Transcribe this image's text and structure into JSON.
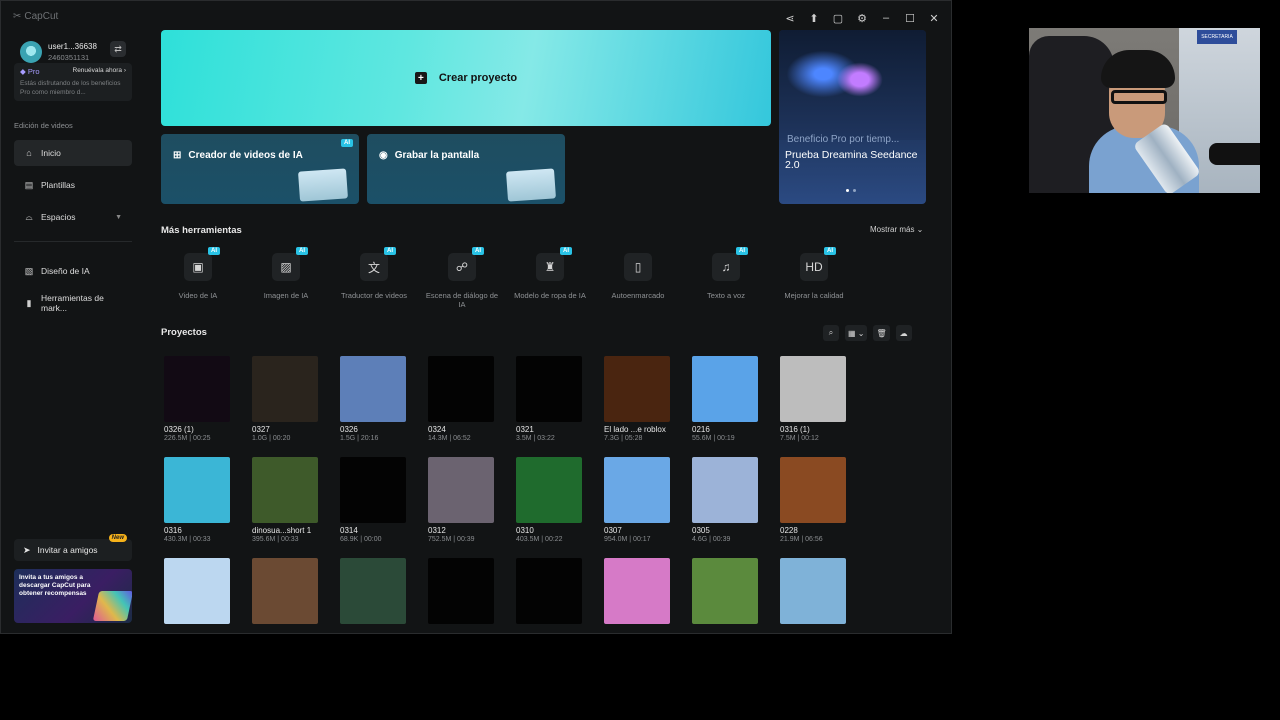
{
  "app": {
    "brand": "CapCut"
  },
  "window_controls": [
    "share",
    "upload",
    "feedback",
    "settings",
    "minimize",
    "maximize",
    "close"
  ],
  "user": {
    "name": "user1...36638",
    "id": "2460351131"
  },
  "pro": {
    "tag": "Pro",
    "renew": "Renuévala ahora",
    "desc": "Estás disfrutando de los beneficios Pro como miembro d..."
  },
  "sidebar": {
    "section_label": "Edición de videos",
    "items": [
      {
        "label": "Inicio",
        "icon": "home-icon"
      },
      {
        "label": "Plantillas",
        "icon": "templates-icon"
      },
      {
        "label": "Espacios",
        "icon": "spaces-icon"
      },
      {
        "label": "Diseño de IA",
        "icon": "ai-design-icon"
      },
      {
        "label": "Herramientas de mark...",
        "icon": "marketing-tools-icon"
      }
    ],
    "invite": {
      "label": "Invitar a amigos",
      "badge": "New"
    },
    "promo": "Invita a tus amigos a descargar CapCut para obtener recompensas"
  },
  "hero": {
    "label": "Crear proyecto"
  },
  "cards": [
    {
      "label": "Creador de videos de IA",
      "badge": "AI"
    },
    {
      "label": "Grabar la pantalla"
    }
  ],
  "banner": {
    "faded": "Beneficio Pro por tiemp...",
    "title": "Prueba Dreamina Seedance 2.0"
  },
  "tools_section": {
    "title": "Más herramientas",
    "more": "Mostrar más"
  },
  "tools": [
    {
      "label": "Video de IA",
      "icon": "▣",
      "ai": "AI"
    },
    {
      "label": "Imagen de IA",
      "icon": "▨",
      "ai": "AI"
    },
    {
      "label": "Traductor de videos",
      "icon": "文",
      "ai": "AI"
    },
    {
      "label": "Escena de diálogo de IA",
      "icon": "☍",
      "ai": "AI"
    },
    {
      "label": "Modelo de ropa de IA",
      "icon": "♜",
      "ai": "AI"
    },
    {
      "label": "Autoenmarcado",
      "icon": "▯",
      "ai": ""
    },
    {
      "label": "Texto a voz",
      "icon": "♫",
      "ai": "AI"
    },
    {
      "label": "Mejorar la calidad",
      "icon": "HD",
      "ai": "AI"
    }
  ],
  "projects_section": {
    "title": "Proyectos"
  },
  "projects": [
    {
      "name": "0326 (1)",
      "meta": "226.5M | 00:25",
      "bg": "#120a14"
    },
    {
      "name": "0327",
      "meta": "1.0G | 00:20",
      "bg": "#2a241d"
    },
    {
      "name": "0326",
      "meta": "1.5G | 20:16",
      "bg": "#5d7fb8"
    },
    {
      "name": "0324",
      "meta": "14.3M | 06:52",
      "bg": "#030303"
    },
    {
      "name": "0321",
      "meta": "3.5M | 03:22",
      "bg": "#030303"
    },
    {
      "name": "El lado ...e roblox",
      "meta": "7.3G | 05:28",
      "bg": "#4a2510"
    },
    {
      "name": "0216",
      "meta": "55.6M | 00:19",
      "bg": "#5aa3e8"
    },
    {
      "name": "0316 (1)",
      "meta": "7.5M | 00:12",
      "bg": "#bdbdbd"
    },
    {
      "name": "0316",
      "meta": "430.3M | 00:33",
      "bg": "#3bb6d6"
    },
    {
      "name": "dinosua...short 1",
      "meta": "395.6M | 00:33",
      "bg": "#3e5a2a"
    },
    {
      "name": "0314",
      "meta": "68.9K | 00:00",
      "bg": "#030303"
    },
    {
      "name": "0312",
      "meta": "752.5M | 00:39",
      "bg": "#6b6370"
    },
    {
      "name": "0310",
      "meta": "403.5M | 00:22",
      "bg": "#1f6b2d"
    },
    {
      "name": "0307",
      "meta": "954.0M | 00:17",
      "bg": "#6aa8e6"
    },
    {
      "name": "0305",
      "meta": "4.6G | 00:39",
      "bg": "#9cb3d8"
    },
    {
      "name": "0228",
      "meta": "21.9M | 06:56",
      "bg": "#8a4a22"
    },
    {
      "name": "",
      "meta": "",
      "bg": "#bcd7f0"
    },
    {
      "name": "",
      "meta": "",
      "bg": "#6b4a33"
    },
    {
      "name": "",
      "meta": "",
      "bg": "#2b4a38"
    },
    {
      "name": "",
      "meta": "",
      "bg": "#030303"
    },
    {
      "name": "",
      "meta": "",
      "bg": "#030303"
    },
    {
      "name": "",
      "meta": "",
      "bg": "#d67ac7"
    },
    {
      "name": "",
      "meta": "",
      "bg": "#5b8a3d"
    },
    {
      "name": "",
      "meta": "",
      "bg": "#7fb2d8"
    }
  ],
  "webcam": {
    "sign": "SECRETARIA"
  }
}
